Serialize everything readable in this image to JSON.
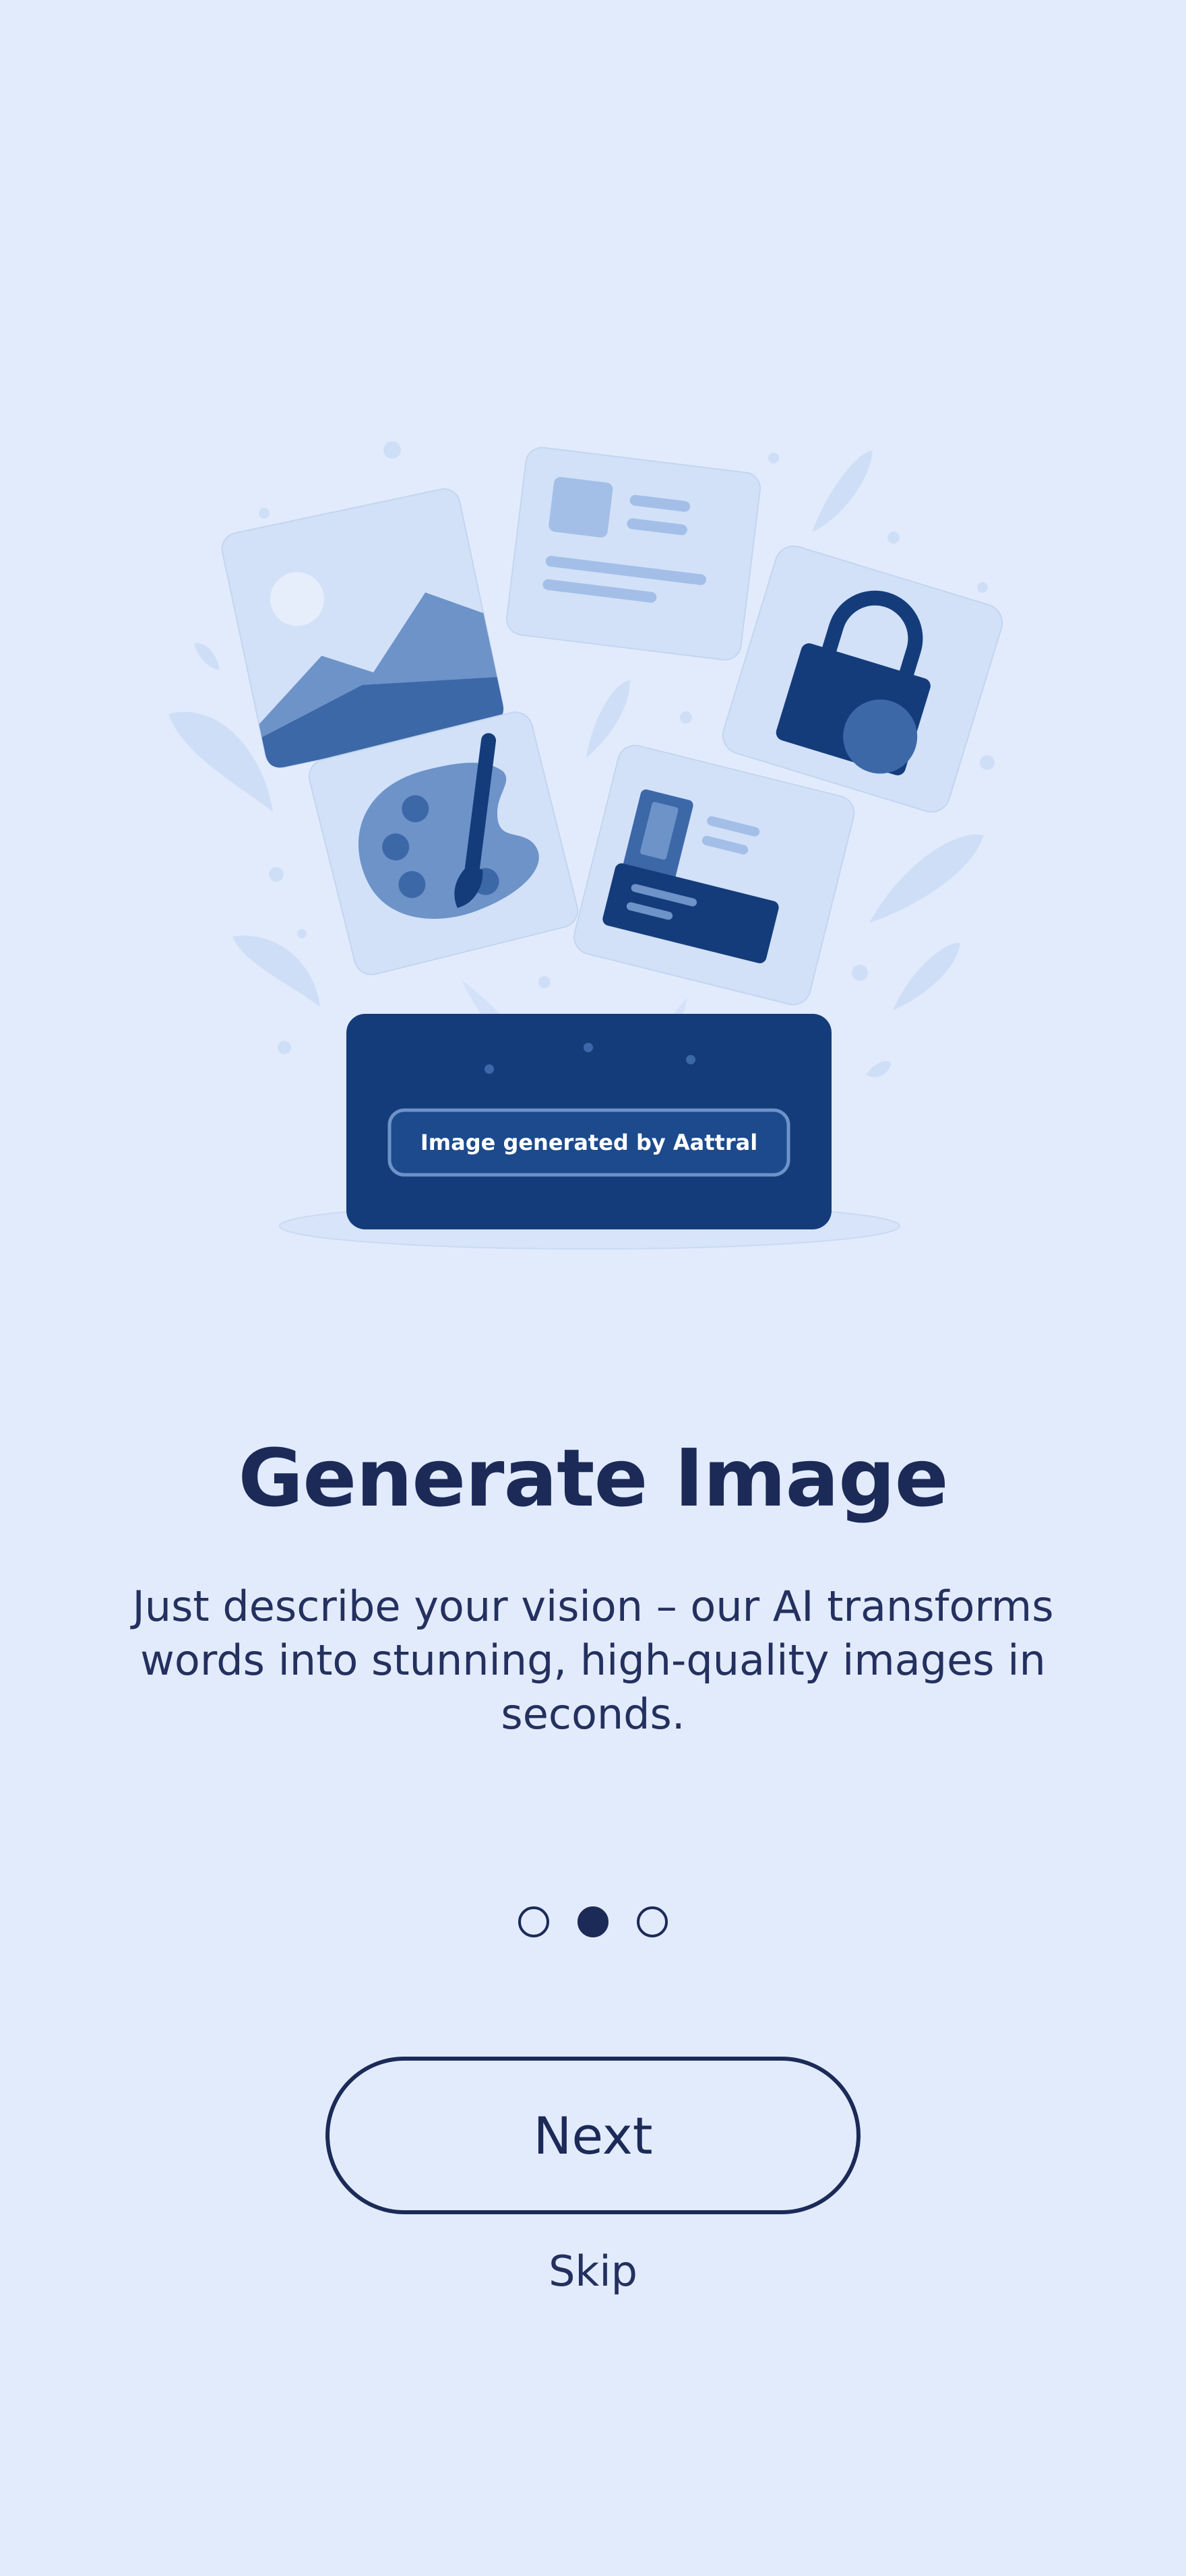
{
  "illustration": {
    "caption": "Image generated by Aattral",
    "icons": [
      "landscape-photo-icon",
      "text-card-icon",
      "padlock-icon",
      "paint-palette-icon",
      "id-card-icon",
      "generator-box-icon"
    ]
  },
  "title": "Generate Image",
  "description": "Just describe your vision – our AI transforms words into stunning, high-quality images in seconds.",
  "pagination": {
    "total": 3,
    "active_index": 1
  },
  "actions": {
    "next_label": "Next",
    "skip_label": "Skip"
  },
  "colors": {
    "background": "#e2ebfc",
    "primary": "#1c2a58",
    "box": "#143c7a",
    "accent": "#3c68a8",
    "light_card": "#d2e1f8"
  }
}
